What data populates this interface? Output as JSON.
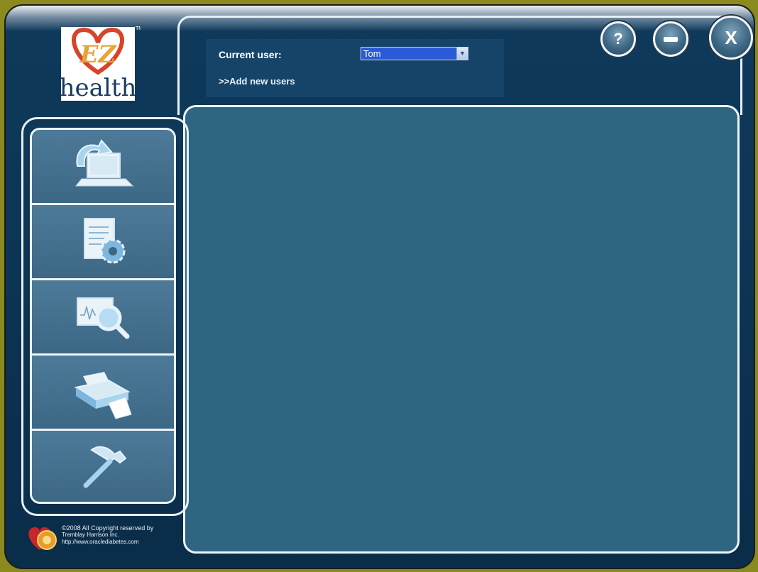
{
  "app": {
    "logo_top": "EZ",
    "logo_bottom": "health",
    "logo_tm": "TM"
  },
  "header": {
    "current_user_label": "Current user:",
    "current_user_value": "Tom",
    "add_users_link": ">>Add new users"
  },
  "controls": {
    "help": "?",
    "close": "X"
  },
  "sidebar": {
    "items": [
      {
        "icon": "transfer-laptop-icon"
      },
      {
        "icon": "document-settings-icon"
      },
      {
        "icon": "chart-search-icon"
      },
      {
        "icon": "printer-icon"
      },
      {
        "icon": "hammer-icon"
      }
    ]
  },
  "footer": {
    "line1": "©2008 All Copyright reserved by",
    "line2": "Tremblay Harrison Inc.",
    "line3": "http://www.oraclediabetes.com"
  },
  "colors": {
    "frame": "#0f3a5c",
    "content": "#2e6583",
    "accent": "#2a5bd6"
  }
}
